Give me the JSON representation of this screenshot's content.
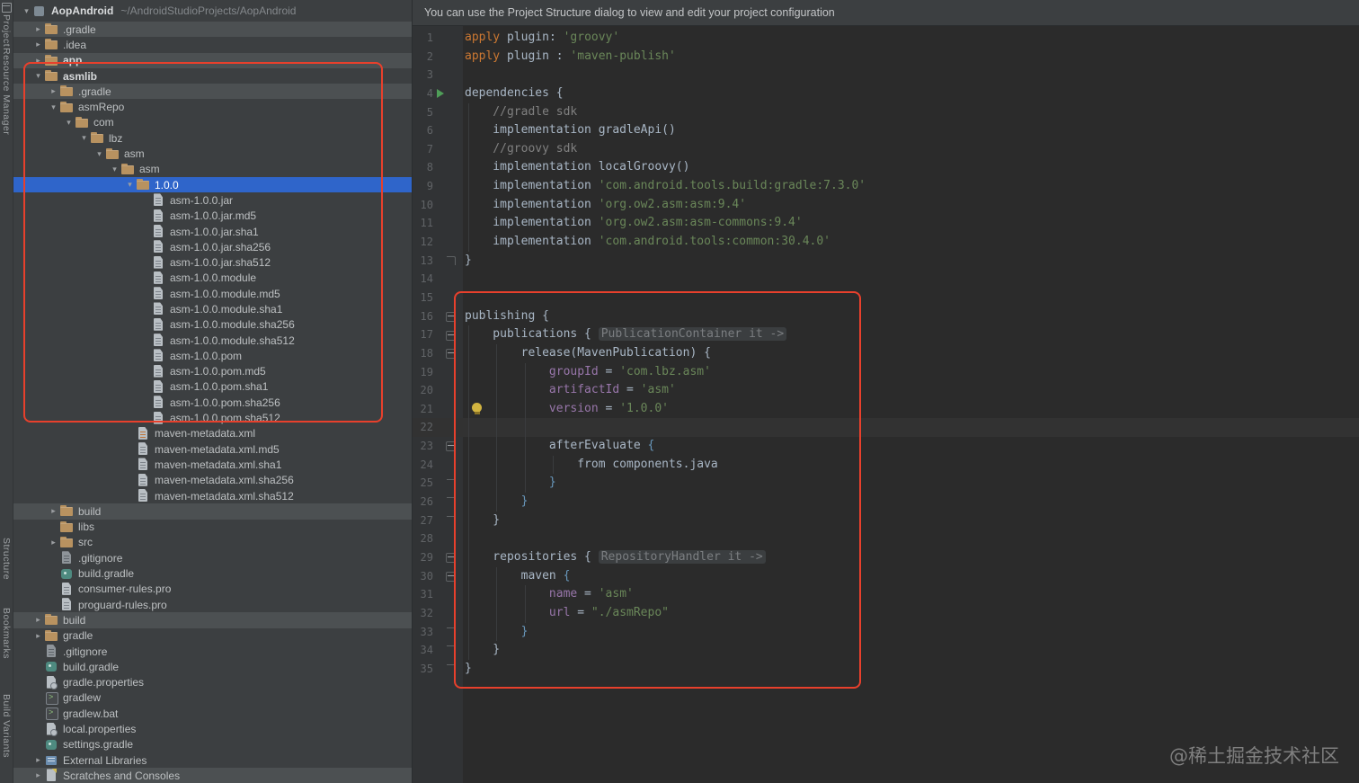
{
  "colors": {
    "annotation": "#e8402c",
    "selection": "#2f65ca",
    "row_highlight": "#4c5052",
    "panel_bg": "#3c3f41",
    "editor_bg": "#2b2b2b"
  },
  "tool_strip": {
    "items": [
      {
        "label": "Project"
      },
      {
        "label": "Resource Manager"
      },
      {
        "label": "Structure"
      },
      {
        "label": "Bookmarks"
      },
      {
        "label": "Build Variants"
      }
    ]
  },
  "project_panel": {
    "root": {
      "name": "AopAndroid",
      "path": "~/AndroidStudioProjects/AopAndroid"
    },
    "tree": [
      {
        "label": ".gradle",
        "depth": 1,
        "icon": "folder",
        "chevron": "collapsed",
        "highlight": "bar"
      },
      {
        "label": ".idea",
        "depth": 1,
        "icon": "folder",
        "chevron": "collapsed"
      },
      {
        "label": "app",
        "depth": 1,
        "icon": "folder",
        "chevron": "collapsed",
        "highlight": "bar",
        "bold": true
      },
      {
        "label": "asmlib",
        "depth": 1,
        "icon": "folder",
        "chevron": "expanded",
        "bold": true
      },
      {
        "label": ".gradle",
        "depth": 2,
        "icon": "folder",
        "chevron": "collapsed",
        "highlight": "bar"
      },
      {
        "label": "asmRepo",
        "depth": 2,
        "icon": "folder",
        "chevron": "expanded"
      },
      {
        "label": "com",
        "depth": 3,
        "icon": "folder",
        "chevron": "expanded"
      },
      {
        "label": "lbz",
        "depth": 4,
        "icon": "folder",
        "chevron": "expanded"
      },
      {
        "label": "asm",
        "depth": 5,
        "icon": "folder",
        "chevron": "expanded"
      },
      {
        "label": "asm",
        "depth": 6,
        "icon": "folder",
        "chevron": "expanded"
      },
      {
        "label": "1.0.0",
        "depth": 7,
        "icon": "folder",
        "chevron": "expanded",
        "highlight": "selected"
      },
      {
        "label": "asm-1.0.0.jar",
        "depth": 8,
        "icon": "file"
      },
      {
        "label": "asm-1.0.0.jar.md5",
        "depth": 8,
        "icon": "file"
      },
      {
        "label": "asm-1.0.0.jar.sha1",
        "depth": 8,
        "icon": "file"
      },
      {
        "label": "asm-1.0.0.jar.sha256",
        "depth": 8,
        "icon": "file"
      },
      {
        "label": "asm-1.0.0.jar.sha512",
        "depth": 8,
        "icon": "file"
      },
      {
        "label": "asm-1.0.0.module",
        "depth": 8,
        "icon": "file"
      },
      {
        "label": "asm-1.0.0.module.md5",
        "depth": 8,
        "icon": "file"
      },
      {
        "label": "asm-1.0.0.module.sha1",
        "depth": 8,
        "icon": "file"
      },
      {
        "label": "asm-1.0.0.module.sha256",
        "depth": 8,
        "icon": "file"
      },
      {
        "label": "asm-1.0.0.module.sha512",
        "depth": 8,
        "icon": "file"
      },
      {
        "label": "asm-1.0.0.pom",
        "depth": 8,
        "icon": "file"
      },
      {
        "label": "asm-1.0.0.pom.md5",
        "depth": 8,
        "icon": "file"
      },
      {
        "label": "asm-1.0.0.pom.sha1",
        "depth": 8,
        "icon": "file"
      },
      {
        "label": "asm-1.0.0.pom.sha256",
        "depth": 8,
        "icon": "file"
      },
      {
        "label": "asm-1.0.0.pom.sha512",
        "depth": 8,
        "icon": "file"
      },
      {
        "label": "maven-metadata.xml",
        "depth": 7,
        "icon": "xml"
      },
      {
        "label": "maven-metadata.xml.md5",
        "depth": 7,
        "icon": "file"
      },
      {
        "label": "maven-metadata.xml.sha1",
        "depth": 7,
        "icon": "file"
      },
      {
        "label": "maven-metadata.xml.sha256",
        "depth": 7,
        "icon": "file"
      },
      {
        "label": "maven-metadata.xml.sha512",
        "depth": 7,
        "icon": "file"
      },
      {
        "label": "build",
        "depth": 2,
        "icon": "folder",
        "chevron": "collapsed",
        "highlight": "bar"
      },
      {
        "label": "libs",
        "depth": 2,
        "icon": "folder"
      },
      {
        "label": "src",
        "depth": 2,
        "icon": "folder",
        "chevron": "collapsed"
      },
      {
        "label": ".gitignore",
        "depth": 2,
        "icon": "ignore"
      },
      {
        "label": "build.gradle",
        "depth": 2,
        "icon": "gradle"
      },
      {
        "label": "consumer-rules.pro",
        "depth": 2,
        "icon": "file"
      },
      {
        "label": "proguard-rules.pro",
        "depth": 2,
        "icon": "file"
      },
      {
        "label": "build",
        "depth": 1,
        "icon": "folder",
        "chevron": "collapsed",
        "highlight": "bar"
      },
      {
        "label": "gradle",
        "depth": 1,
        "icon": "folder",
        "chevron": "collapsed"
      },
      {
        "label": ".gitignore",
        "depth": 1,
        "icon": "ignore"
      },
      {
        "label": "build.gradle",
        "depth": 1,
        "icon": "gradle"
      },
      {
        "label": "gradle.properties",
        "depth": 1,
        "icon": "props"
      },
      {
        "label": "gradlew",
        "depth": 1,
        "icon": "script"
      },
      {
        "label": "gradlew.bat",
        "depth": 1,
        "icon": "script"
      },
      {
        "label": "local.properties",
        "depth": 1,
        "icon": "props"
      },
      {
        "label": "settings.gradle",
        "depth": 1,
        "icon": "gradle"
      },
      {
        "label": "External Libraries",
        "depth": 1,
        "icon": "lib",
        "chevron": "collapsed"
      },
      {
        "label": "Scratches and Consoles",
        "depth": 1,
        "icon": "scratch",
        "chevron": "collapsed",
        "highlight": "bar"
      }
    ]
  },
  "notification": {
    "text": "You can use the Project Structure dialog to view and edit your project configuration"
  },
  "editor": {
    "palette": {
      "kw": "#cc7832",
      "str": "#6a8759",
      "cmt": "#808080",
      "prop": "#9876aa",
      "def": "#a9b7c6",
      "blu": "#6897bb",
      "hint": "#7b7e81"
    },
    "lines": [
      {
        "num": 1,
        "tokens": [
          [
            "kw",
            "apply"
          ],
          [
            "def",
            " plugin"
          ],
          [
            "def",
            ": "
          ],
          [
            "str",
            "'groovy'"
          ]
        ]
      },
      {
        "num": 2,
        "tokens": [
          [
            "kw",
            "apply"
          ],
          [
            "def",
            " plugin "
          ],
          [
            "def",
            ": "
          ],
          [
            "str",
            "'maven-publish'"
          ]
        ]
      },
      {
        "num": 3,
        "tokens": []
      },
      {
        "num": 4,
        "gutter": "run",
        "tokens": [
          [
            "def",
            "dependencies {"
          ]
        ]
      },
      {
        "num": 5,
        "guides": 1,
        "tokens": [
          [
            "cmt",
            "    //gradle sdk"
          ]
        ]
      },
      {
        "num": 6,
        "guides": 1,
        "tokens": [
          [
            "def",
            "    implementation gradleApi()"
          ]
        ]
      },
      {
        "num": 7,
        "guides": 1,
        "tokens": [
          [
            "cmt",
            "    //groovy sdk"
          ]
        ]
      },
      {
        "num": 8,
        "guides": 1,
        "tokens": [
          [
            "def",
            "    implementation localGroovy()"
          ]
        ]
      },
      {
        "num": 9,
        "guides": 1,
        "tokens": [
          [
            "def",
            "    implementation "
          ],
          [
            "str",
            "'com.android.tools.build:gradle:7.3.0'"
          ]
        ]
      },
      {
        "num": 10,
        "guides": 1,
        "tokens": [
          [
            "def",
            "    implementation "
          ],
          [
            "str",
            "'org.ow2.asm:asm:9.4'"
          ]
        ]
      },
      {
        "num": 11,
        "guides": 1,
        "tokens": [
          [
            "def",
            "    implementation "
          ],
          [
            "str",
            "'org.ow2.asm:asm-commons:9.4'"
          ]
        ]
      },
      {
        "num": 12,
        "guides": 1,
        "tokens": [
          [
            "def",
            "    implementation "
          ],
          [
            "str",
            "'com.android.tools:common:30.4.0'"
          ]
        ]
      },
      {
        "num": 13,
        "gutter": "foldend",
        "tokens": [
          [
            "def",
            "}"
          ]
        ]
      },
      {
        "num": 14,
        "tokens": []
      },
      {
        "num": 15,
        "tokens": []
      },
      {
        "num": 16,
        "gutter": "fold",
        "tokens": [
          [
            "def",
            "publishing {"
          ]
        ]
      },
      {
        "num": 17,
        "guides": 1,
        "gutter": "fold",
        "tokens": [
          [
            "def",
            "    publications { "
          ],
          [
            "hint",
            "PublicationContainer it ->"
          ]
        ]
      },
      {
        "num": 18,
        "guides": 2,
        "gutter": "fold",
        "tokens": [
          [
            "def",
            "        release(MavenPublication) {"
          ]
        ]
      },
      {
        "num": 19,
        "guides": 3,
        "tokens": [
          [
            "prop",
            "            groupId"
          ],
          [
            "def",
            " = "
          ],
          [
            "str",
            "'com.lbz.asm'"
          ]
        ]
      },
      {
        "num": 20,
        "guides": 3,
        "tokens": [
          [
            "prop",
            "            artifactId"
          ],
          [
            "def",
            " = "
          ],
          [
            "str",
            "'asm'"
          ]
        ]
      },
      {
        "num": 21,
        "guides": 3,
        "tokens": [
          [
            "prop",
            "            version"
          ],
          [
            "def",
            " = "
          ],
          [
            "str",
            "'1.0.0'"
          ]
        ]
      },
      {
        "num": 22,
        "guides": 3,
        "caret": true,
        "tokens": []
      },
      {
        "num": 23,
        "guides": 3,
        "gutter": "fold",
        "tokens": [
          [
            "def",
            "            afterEvaluate "
          ],
          [
            "blu",
            "{"
          ]
        ]
      },
      {
        "num": 24,
        "guides": 4,
        "tokens": [
          [
            "def",
            "                from components.java"
          ]
        ]
      },
      {
        "num": 25,
        "guides": 3,
        "gutter": "foldend",
        "tokens": [
          [
            "blu",
            "            }"
          ]
        ]
      },
      {
        "num": 26,
        "guides": 2,
        "gutter": "foldend",
        "tokens": [
          [
            "blu",
            "        }"
          ]
        ]
      },
      {
        "num": 27,
        "guides": 1,
        "gutter": "foldend",
        "tokens": [
          [
            "def",
            "    }"
          ]
        ]
      },
      {
        "num": 28,
        "guides": 1,
        "tokens": []
      },
      {
        "num": 29,
        "guides": 1,
        "gutter": "fold",
        "tokens": [
          [
            "def",
            "    repositories { "
          ],
          [
            "hint",
            "RepositoryHandler it ->"
          ]
        ]
      },
      {
        "num": 30,
        "guides": 2,
        "gutter": "fold",
        "tokens": [
          [
            "def",
            "        maven "
          ],
          [
            "blu",
            "{"
          ]
        ]
      },
      {
        "num": 31,
        "guides": 3,
        "tokens": [
          [
            "prop",
            "            name"
          ],
          [
            "def",
            " = "
          ],
          [
            "str",
            "'asm'"
          ]
        ]
      },
      {
        "num": 32,
        "guides": 3,
        "tokens": [
          [
            "prop",
            "            url"
          ],
          [
            "def",
            " = "
          ],
          [
            "str",
            "\"./asmRepo\""
          ]
        ]
      },
      {
        "num": 33,
        "guides": 2,
        "gutter": "foldend",
        "tokens": [
          [
            "blu",
            "        }"
          ]
        ]
      },
      {
        "num": 34,
        "guides": 1,
        "gutter": "foldend",
        "tokens": [
          [
            "def",
            "    }"
          ]
        ]
      },
      {
        "num": 35,
        "gutter": "foldend",
        "tokens": [
          [
            "def",
            "}"
          ]
        ]
      }
    ]
  },
  "watermark": {
    "text": "@稀土掘金技术社区"
  }
}
